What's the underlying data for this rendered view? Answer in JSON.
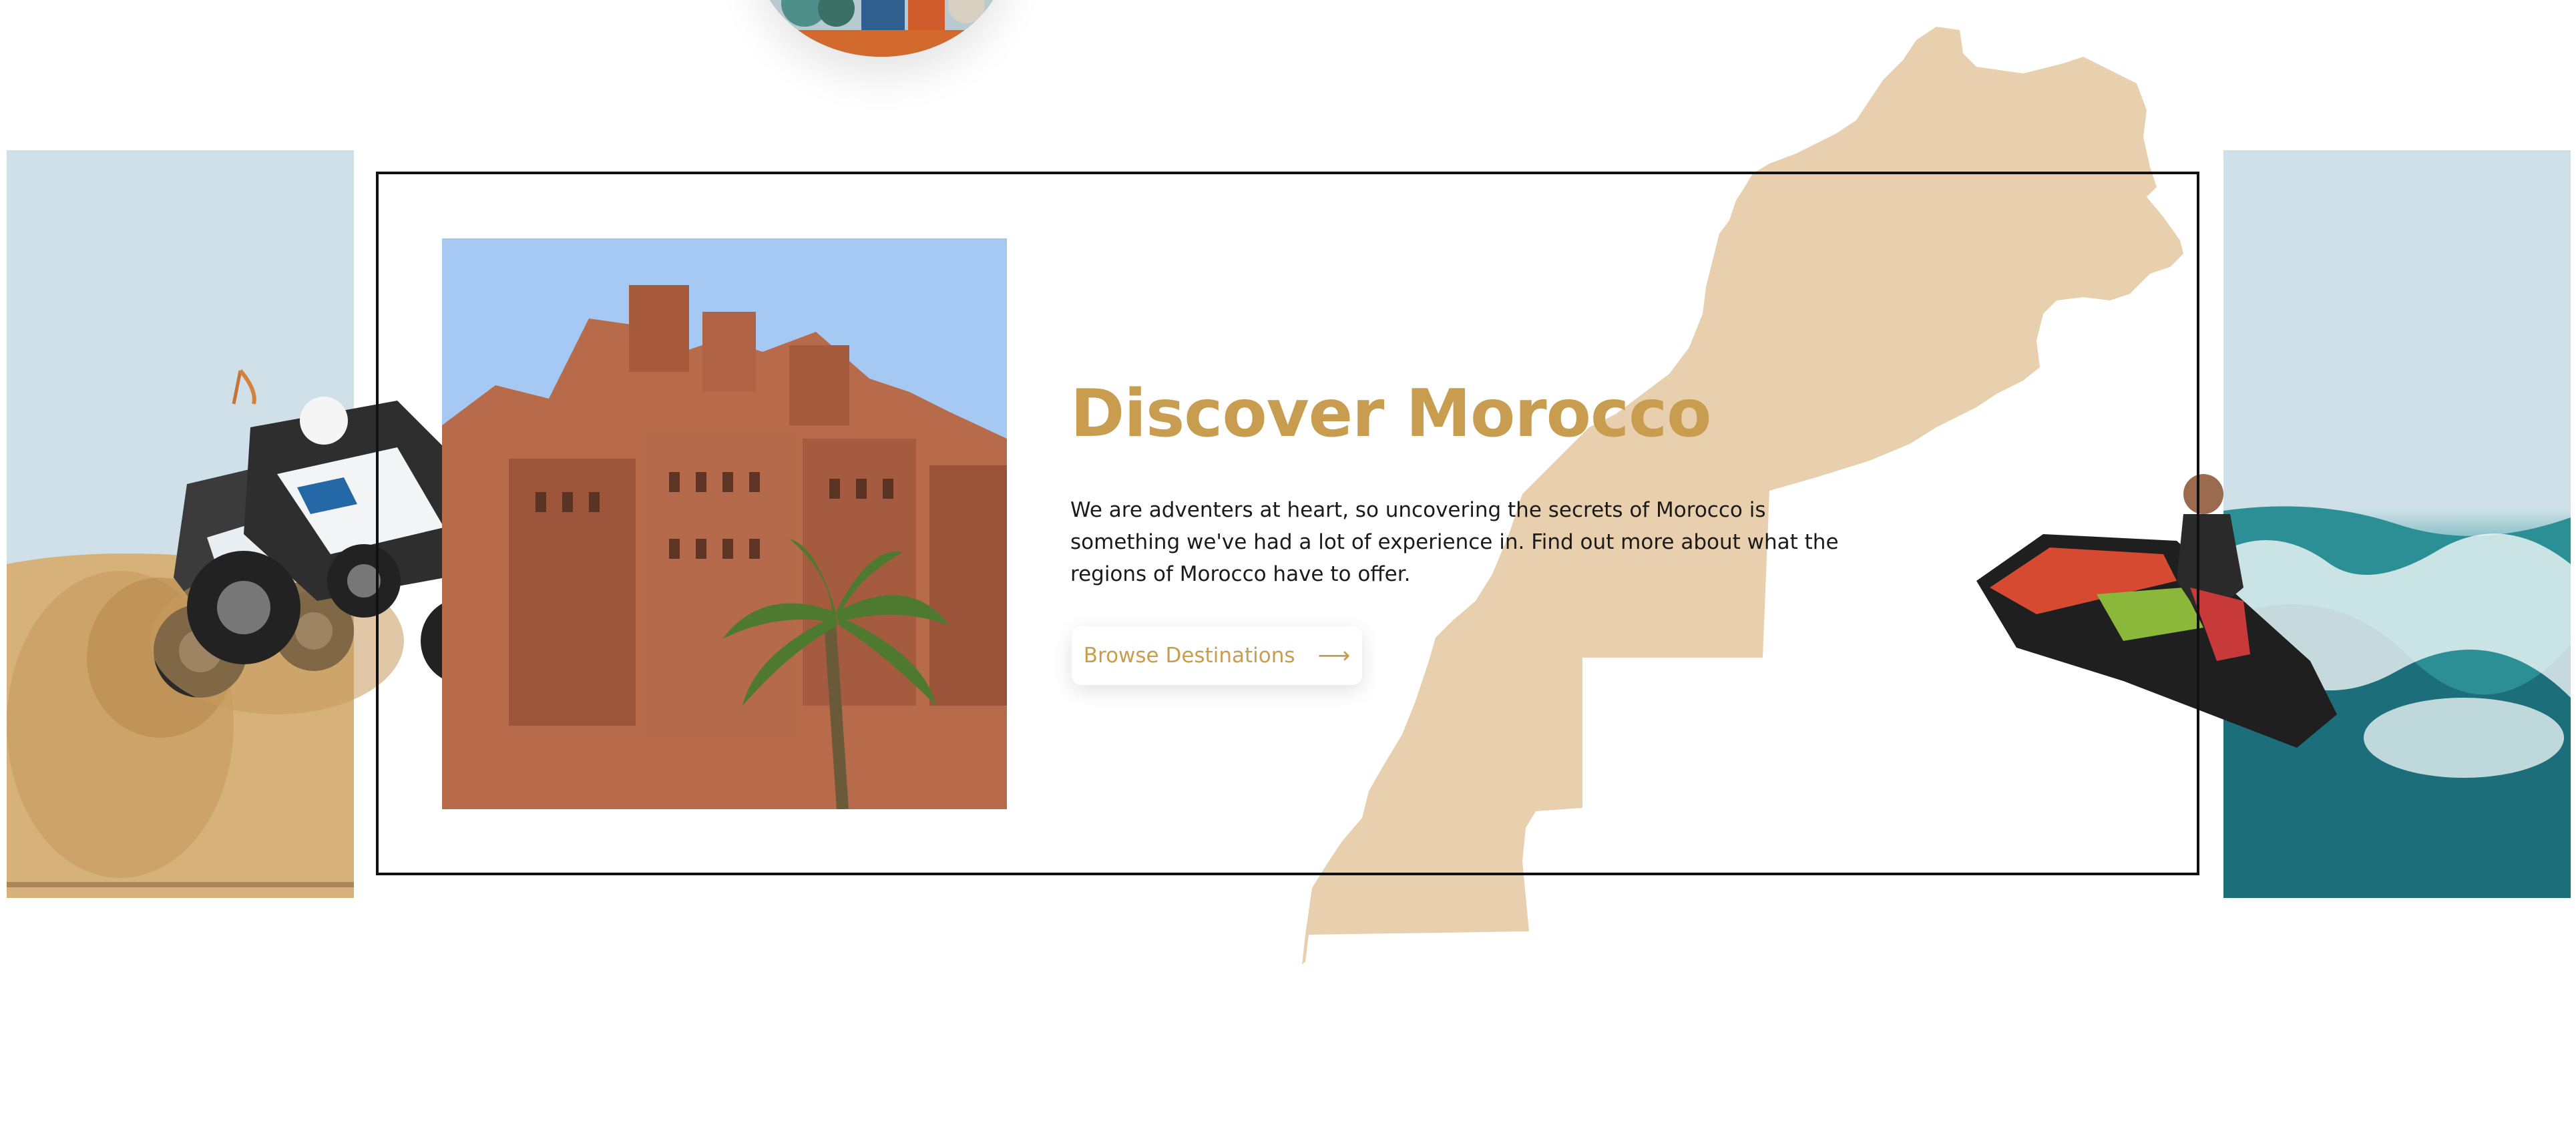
{
  "hero": {
    "title": "Discover Morocco",
    "description": "We are adventers at heart, so uncovering the secrets of Morocco is something we've had a lot of experience in. Find out more about what the regions of Morocco have to offer.",
    "cta_label": "Browse Destinations",
    "cta_icon": "arrow-right-icon"
  },
  "images": {
    "top": "mosaic-circle",
    "left": "buggy-dune",
    "center": "kasbah-palm",
    "right": "jet-ski"
  },
  "colors": {
    "accent": "#c89d4f",
    "map": "#e8cfae",
    "frame": "#111111",
    "text": "#1a1a1a"
  }
}
